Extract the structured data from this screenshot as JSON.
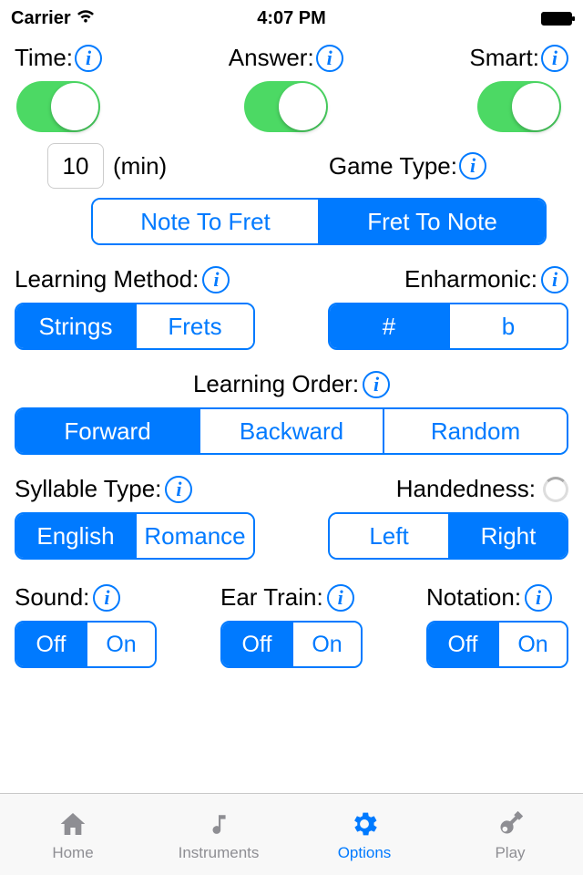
{
  "status": {
    "carrier": "Carrier",
    "time": "4:07 PM"
  },
  "toggles": {
    "time": {
      "label": "Time:"
    },
    "answer": {
      "label": "Answer:"
    },
    "smart": {
      "label": "Smart:"
    }
  },
  "time_input": {
    "value": "10",
    "unit": "(min)"
  },
  "game_type": {
    "label": "Game Type:",
    "opt1": "Note To Fret",
    "opt2": "Fret To Note",
    "selected": 1
  },
  "learning_method": {
    "label": "Learning Method:",
    "opt1": "Strings",
    "opt2": "Frets"
  },
  "enharmonic": {
    "label": "Enharmonic:",
    "opt1": "#",
    "opt2": "b"
  },
  "learning_order": {
    "label": "Learning Order:",
    "opt1": "Forward",
    "opt2": "Backward",
    "opt3": "Random"
  },
  "syllable": {
    "label": "Syllable Type:",
    "opt1": "English",
    "opt2": "Romance"
  },
  "handedness": {
    "label": "Handedness:",
    "opt1": "Left",
    "opt2": "Right"
  },
  "sound": {
    "label": "Sound:",
    "off": "Off",
    "on": "On"
  },
  "ear_train": {
    "label": "Ear Train:",
    "off": "Off",
    "on": "On"
  },
  "notation": {
    "label": "Notation:",
    "off": "Off",
    "on": "On"
  },
  "tabs": {
    "home": "Home",
    "instruments": "Instruments",
    "options": "Options",
    "play": "Play"
  }
}
